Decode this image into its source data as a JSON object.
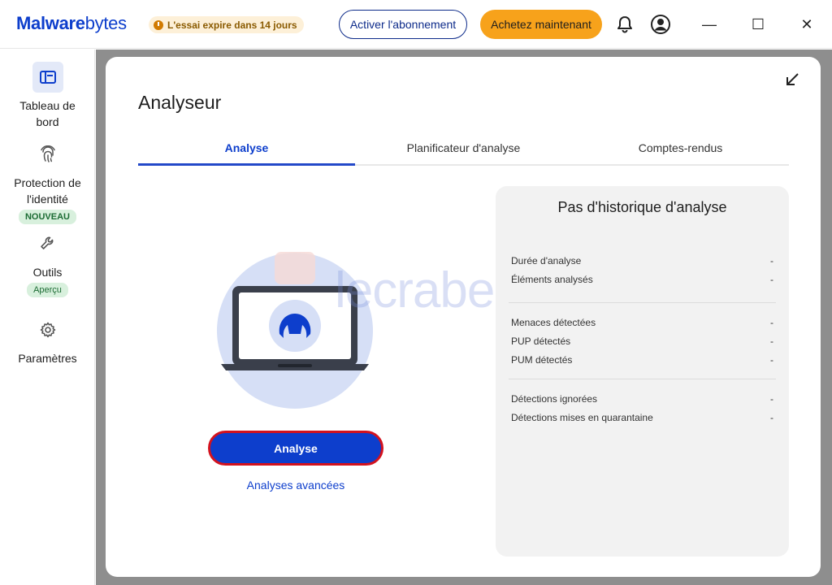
{
  "app": {
    "logo_bold": "Malware",
    "logo_rest": "bytes",
    "trial_text": "L'essai expire dans 14 jours",
    "activate_label": "Activer l'abonnement",
    "buy_label": "Achetez maintenant"
  },
  "window": {
    "minimize": "—",
    "maximize": "☐",
    "close": "✕"
  },
  "sidebar": {
    "items": [
      {
        "label": "Tableau de bord",
        "icon": "dashboard-icon",
        "badge": ""
      },
      {
        "label": "Protection de l'identité",
        "icon": "fingerprint-icon",
        "badge": "NOUVEAU"
      },
      {
        "label": "Outils",
        "icon": "wrench-icon",
        "badge": "Aperçu"
      },
      {
        "label": "Paramètres",
        "icon": "gear-icon",
        "badge": ""
      }
    ]
  },
  "main": {
    "title": "Analyseur",
    "tabs": [
      {
        "label": "Analyse",
        "active": true
      },
      {
        "label": "Planificateur d'analyse",
        "active": false
      },
      {
        "label": "Comptes-rendus",
        "active": false
      }
    ],
    "scan_button": "Analyse",
    "advanced_link": "Analyses avancées"
  },
  "history": {
    "title": "Pas d'historique d'analyse",
    "rows": [
      {
        "label": "Durée d'analyse",
        "value": "-"
      },
      {
        "label": "Éléments analysés",
        "value": "-"
      },
      {
        "label": "Menaces détectées",
        "value": "-"
      },
      {
        "label": "PUP détectés",
        "value": "-"
      },
      {
        "label": "PUM détectés",
        "value": "-"
      },
      {
        "label": "Détections ignorées",
        "value": "-"
      },
      {
        "label": "Détections mises en quarantaine",
        "value": "-"
      }
    ]
  },
  "watermark": "lecrabeinfo",
  "colors": {
    "brand_blue": "#0d3ecc",
    "buy_orange": "#f7a21b",
    "scan_border_red": "#d3121e"
  }
}
